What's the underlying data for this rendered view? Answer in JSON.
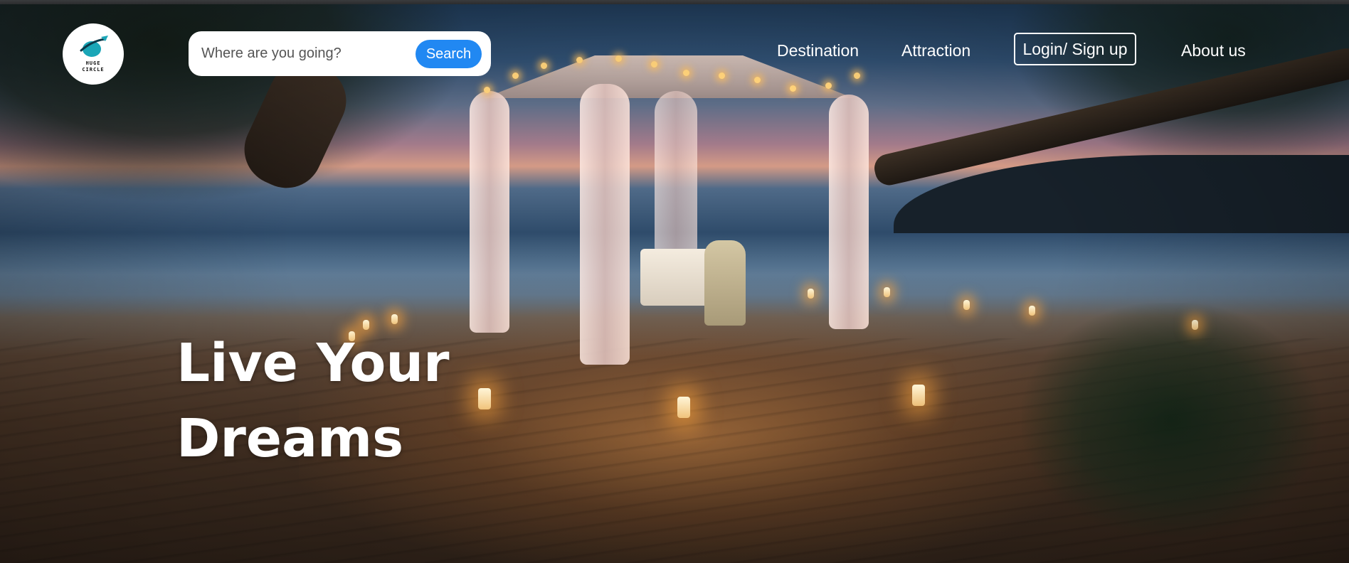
{
  "logo": {
    "line1": "HUGE",
    "line2": "CIRCLE",
    "icon": "globe-plane-icon",
    "accent": "#1aa6b7"
  },
  "search": {
    "placeholder": "Where are you going?",
    "value": "",
    "button_label": "Search",
    "button_color": "#2188f2"
  },
  "nav": {
    "destination": "Destination",
    "attraction": "Attraction",
    "login": "Login/ Sign up",
    "about": "About us"
  },
  "hero": {
    "title_line1": "Live Your",
    "title_line2": "Dreams",
    "background": "beach-dinner-gazebo-sunset-photo"
  }
}
